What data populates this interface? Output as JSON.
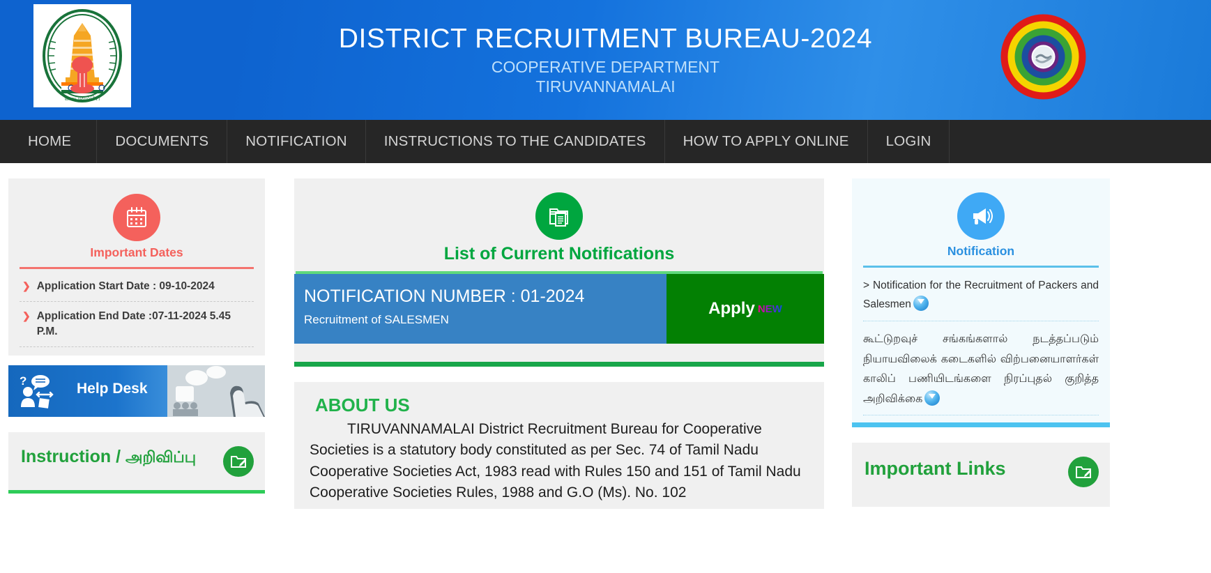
{
  "header": {
    "title": "DISTRICT RECRUITMENT BUREAU-2024",
    "subtitle": "COOPERATIVE DEPARTMENT",
    "subtitle2": "TIRUVANNAMALAI",
    "emblem_alt": "tamil-nadu-government-emblem",
    "right_logo_alt": "cooperative-rainbow-logo",
    "bg_color": "#0e63cf",
    "title_color": "#ffffff",
    "subtitle_color": "#bfe0fb"
  },
  "nav": {
    "items": [
      {
        "label": "HOME"
      },
      {
        "label": "DOCUMENTS"
      },
      {
        "label": "NOTIFICATION"
      },
      {
        "label": "INSTRUCTIONS TO THE CANDIDATES"
      },
      {
        "label": "HOW TO APPLY ONLINE"
      },
      {
        "label": "LOGIN"
      }
    ],
    "bg_color": "#262626",
    "text_color": "#d4d4d4"
  },
  "important_dates": {
    "title": "Important Dates",
    "icon": "calendar-icon",
    "accent": "#f4615c",
    "items": [
      {
        "text": "Application Start Date : 09-10-2024"
      },
      {
        "text": "Application End Date :07-11-2024 5.45 P.M."
      }
    ]
  },
  "help_desk": {
    "label": "Help Desk",
    "icon": "help-desk-icon"
  },
  "instruction": {
    "title_en": "Instruction / ",
    "title_ta": "அறிவிப்பு",
    "icon": "folder-edit-icon",
    "accent": "#21a13c"
  },
  "notifications": {
    "title": "List of Current Notifications",
    "icon": "documents-folder-icon",
    "accent": "#00a63f",
    "rows": [
      {
        "number": "NOTIFICATION NUMBER : 01-2024",
        "description": "Recruitment of SALESMEN",
        "apply_label": "Apply",
        "badge": "NEW"
      }
    ]
  },
  "about": {
    "title": "ABOUT US",
    "body": "TIRUVANNAMALAI District Recruitment Bureau for Cooperative Societies is a statutory body constituted as per Sec. 74 of Tamil Nadu Cooperative Societies Act, 1983 read with Rules 150 and 151 of Tamil Nadu Cooperative Societies Rules, 1988 and G.O (Ms). No. 102"
  },
  "notice": {
    "title": "Notification",
    "icon": "megaphone-icon",
    "accent": "#2a90e0",
    "items": [
      {
        "text": "> Notification for the Recruitment of Packers and Salesmen",
        "icon": "download-icon"
      },
      {
        "text": "கூட்டுறவுச் சங்கங்களால் நடத்தப்படும் நியாயவிலைக் கடைகளில் விற்பனையாளர்கள் காலிப் பணியிடங்களை நிரப்புதல் குறித்த அறிவிக்கை",
        "icon": "download-icon"
      }
    ]
  },
  "important_links": {
    "title": "Important Links",
    "icon": "folder-edit-icon",
    "accent": "#21a13c"
  }
}
